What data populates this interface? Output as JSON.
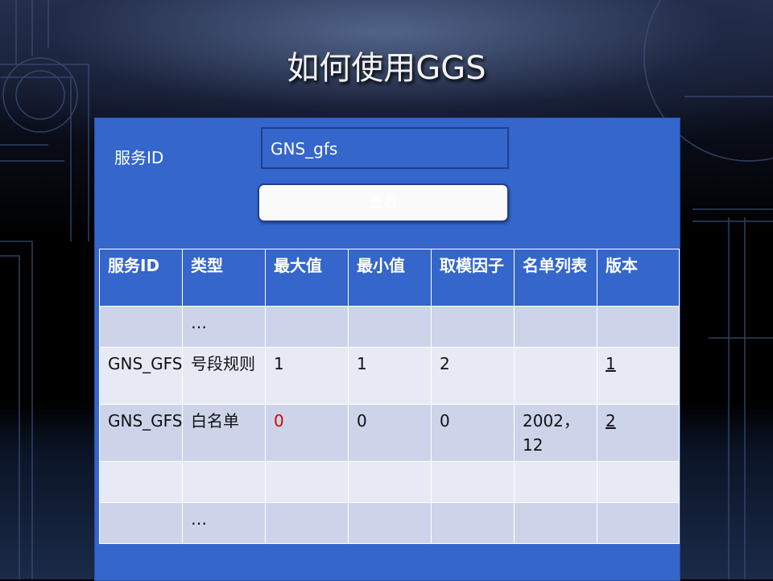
{
  "slide": {
    "title": "如何使用GGS"
  },
  "form": {
    "label": "服务ID",
    "input_value": "GNS_gfs",
    "button_label": "查看"
  },
  "table": {
    "headers": [
      "服务ID",
      "类型",
      "最大值",
      "最小值",
      "取模因子",
      "名单列表",
      "版本"
    ],
    "rows": [
      [
        "",
        "…",
        "",
        "",
        "",
        "",
        ""
      ],
      [
        "GNS_GFS",
        "号段规则",
        "1",
        "1",
        "2",
        "",
        "1"
      ],
      [
        "GNS_GFS",
        "白名单",
        "0",
        "0",
        "0",
        "2002，12",
        "2"
      ],
      [
        "",
        "",
        "",
        "",
        "",
        "",
        ""
      ],
      [
        "",
        "…",
        "",
        "",
        "",
        "",
        ""
      ]
    ]
  },
  "colors": {
    "panel": "#3466cc",
    "row_alt": "#cdd4ea",
    "row_light": "#e7eaf5",
    "highlight_value": "#dd0000"
  }
}
